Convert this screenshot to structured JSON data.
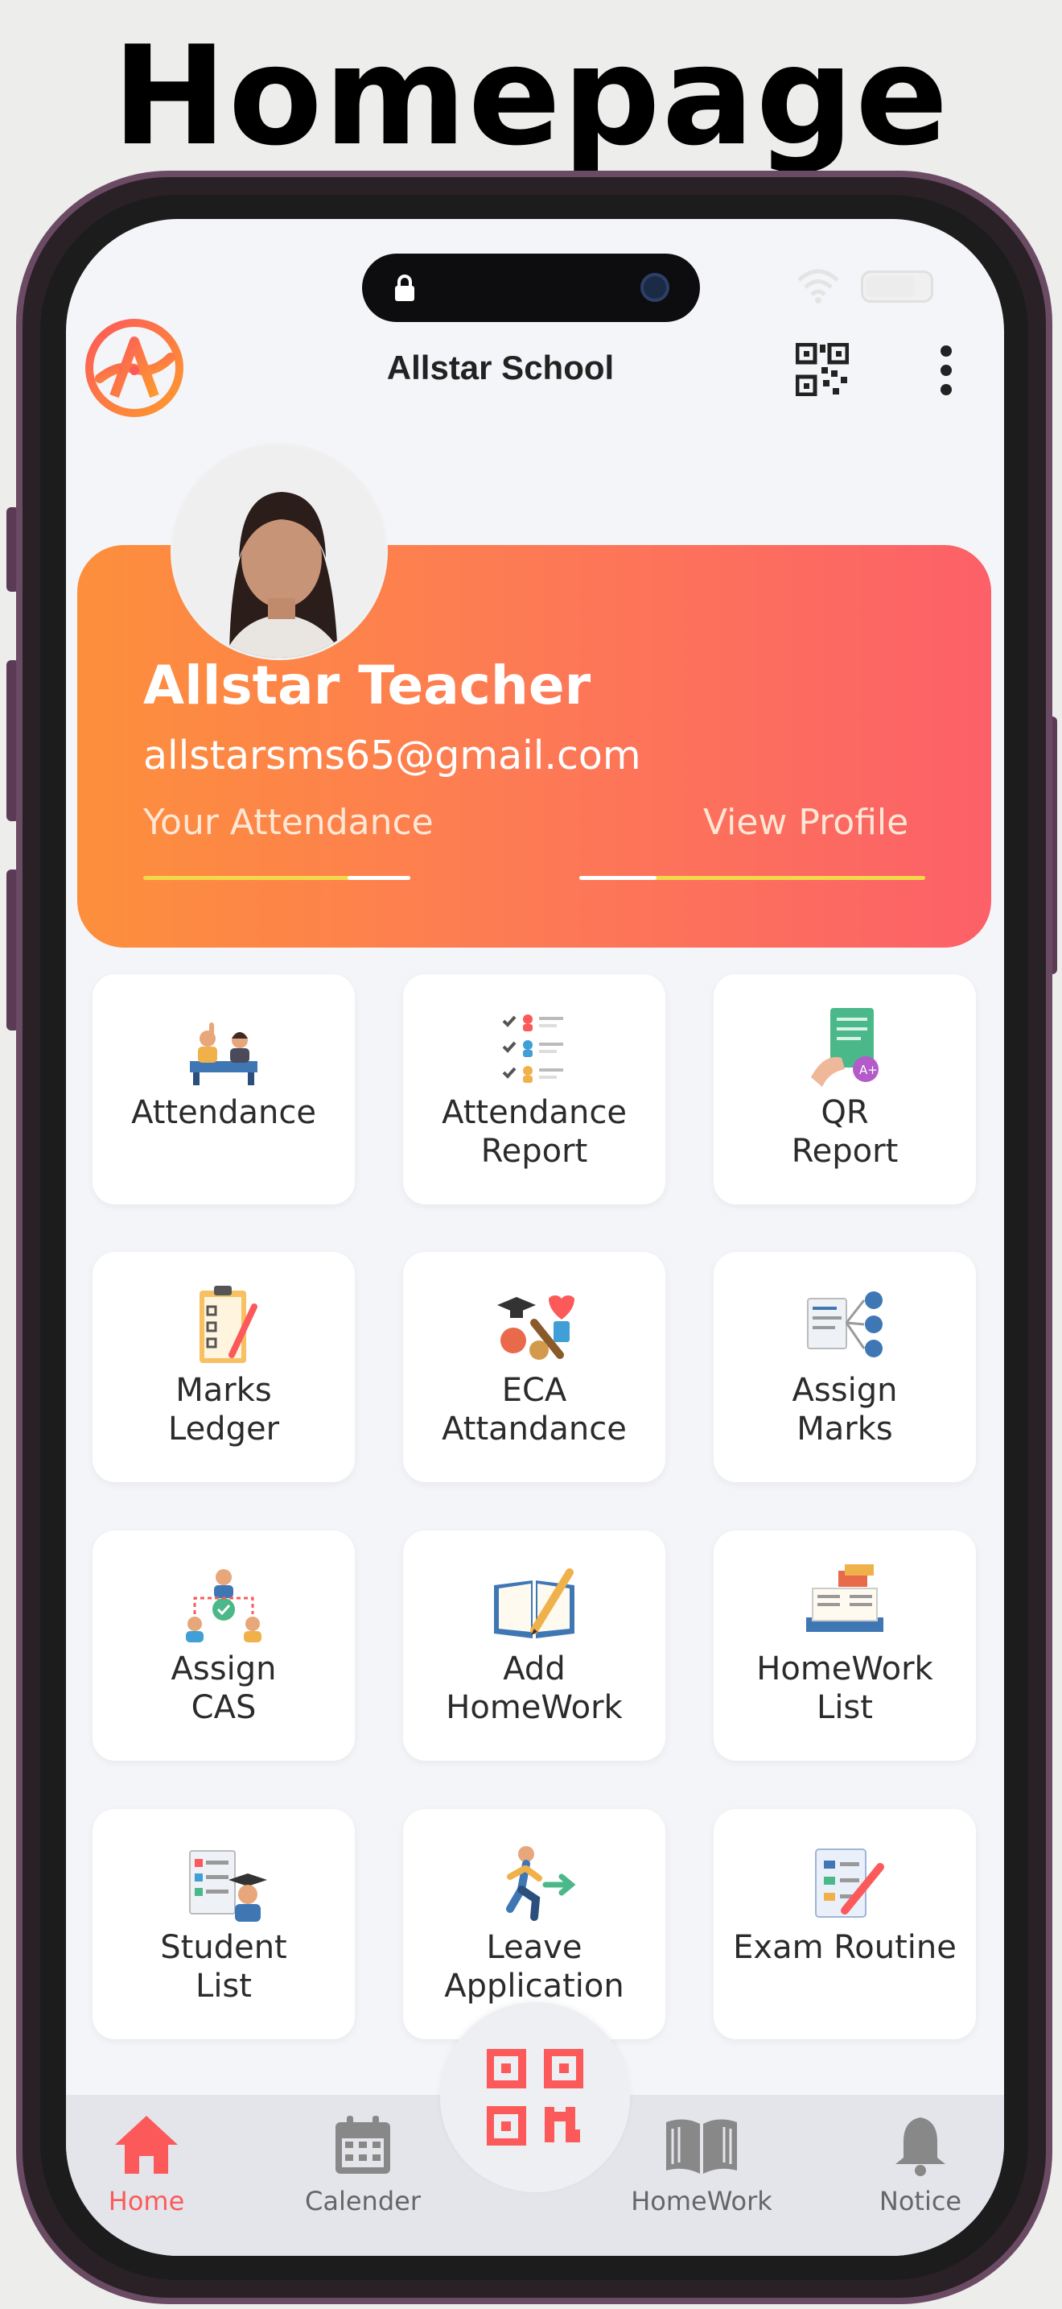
{
  "page_heading": "Homepage",
  "app": {
    "school_name": "Allstar School"
  },
  "profile": {
    "name": "Allstar Teacher",
    "email": "allstarsms65@gmail.com",
    "attendance_link": "Your Attendance",
    "profile_link": "View Profile"
  },
  "tiles": [
    {
      "label": "Attendance",
      "icon": "attendance-icon"
    },
    {
      "label": "Attendance\nReport",
      "icon": "attendance-report-icon"
    },
    {
      "label": "QR\nReport",
      "icon": "qr-report-icon"
    },
    {
      "label": "Marks\nLedger",
      "icon": "marks-ledger-icon"
    },
    {
      "label": "ECA\nAttandance",
      "icon": "eca-icon"
    },
    {
      "label": "Assign\nMarks",
      "icon": "assign-marks-icon"
    },
    {
      "label": "Assign\nCAS",
      "icon": "assign-cas-icon"
    },
    {
      "label": "Add\nHomeWork",
      "icon": "add-homework-icon"
    },
    {
      "label": "HomeWork\nList",
      "icon": "homework-list-icon"
    },
    {
      "label": "Student\nList",
      "icon": "student-list-icon"
    },
    {
      "label": "Leave\nApplication",
      "icon": "leave-application-icon"
    },
    {
      "label": "Exam Routine",
      "icon": "exam-routine-icon"
    }
  ],
  "bottom_nav": {
    "home": "Home",
    "calendar": "Calender",
    "homework": "HomeWork",
    "notice": "Notice"
  },
  "colors": {
    "accent": "#fc5a5a",
    "card_gradient_start": "#fd8f3c",
    "card_gradient_end": "#fc6068"
  }
}
